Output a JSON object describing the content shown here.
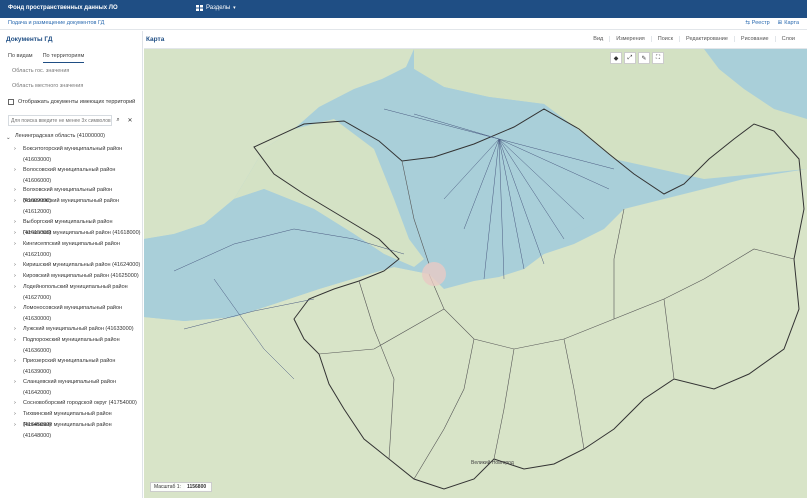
{
  "topbar": {
    "app_title": "Фонд пространственных данных ЛО",
    "sections_label": "Разделы"
  },
  "subbar": {
    "link": "Подача и размещение документов ГД",
    "registry_label": "Реестр",
    "map_label": "Карта"
  },
  "sidebar": {
    "title": "Документы ГД",
    "tabs": [
      "По видам",
      "По территориям"
    ],
    "filter_regional": "Область гос. значения",
    "filter_local": "Область местного значения",
    "checkbox_label": "Отображать документы имеющих территорий",
    "search_placeholder": "Для поиска введите не менее 3х символов",
    "tree_root": "Ленинградская область (41000000)",
    "tree_items": [
      "Бокситогорский муниципальный район (41603000)",
      "Волосовский муниципальный район (41606000)",
      "Волховский муниципальный район (41609000)",
      "Всеволожский муниципальный район (41612000)",
      "Выборгский муниципальный район (41615000)",
      "Гатчинский муниципальный район (41618000)",
      "Кингисеппский муниципальный район (41621000)",
      "Киришский муниципальный район (41624000)",
      "Кировский муниципальный район (41625000)",
      "Лодейнопольский муниципальный район (41627000)",
      "Ломоносовский муниципальный район (41630000)",
      "Лужский муниципальный район (41633000)",
      "Подпорожский муниципальный район (41636000)",
      "Приозерский муниципальный район (41639000)",
      "Сланцевский муниципальный район (41642000)",
      "Сосновоборский городской округ (41754000)",
      "Тихвинский муниципальный район (41645000)",
      "Тосненский муниципальный район (41648000)"
    ]
  },
  "map_panel": {
    "title": "Карта",
    "tools": [
      "Вид",
      "Измерения",
      "Поиск",
      "Редактирование",
      "Рисование",
      "Слои"
    ],
    "scale_label": "Масштаб 1:",
    "scale_value": "1156800",
    "place_label": "Великий Новгород"
  },
  "colors": {
    "header": "#1f4e84",
    "water": "#a9cfd9",
    "land": "#d6e3c7"
  }
}
